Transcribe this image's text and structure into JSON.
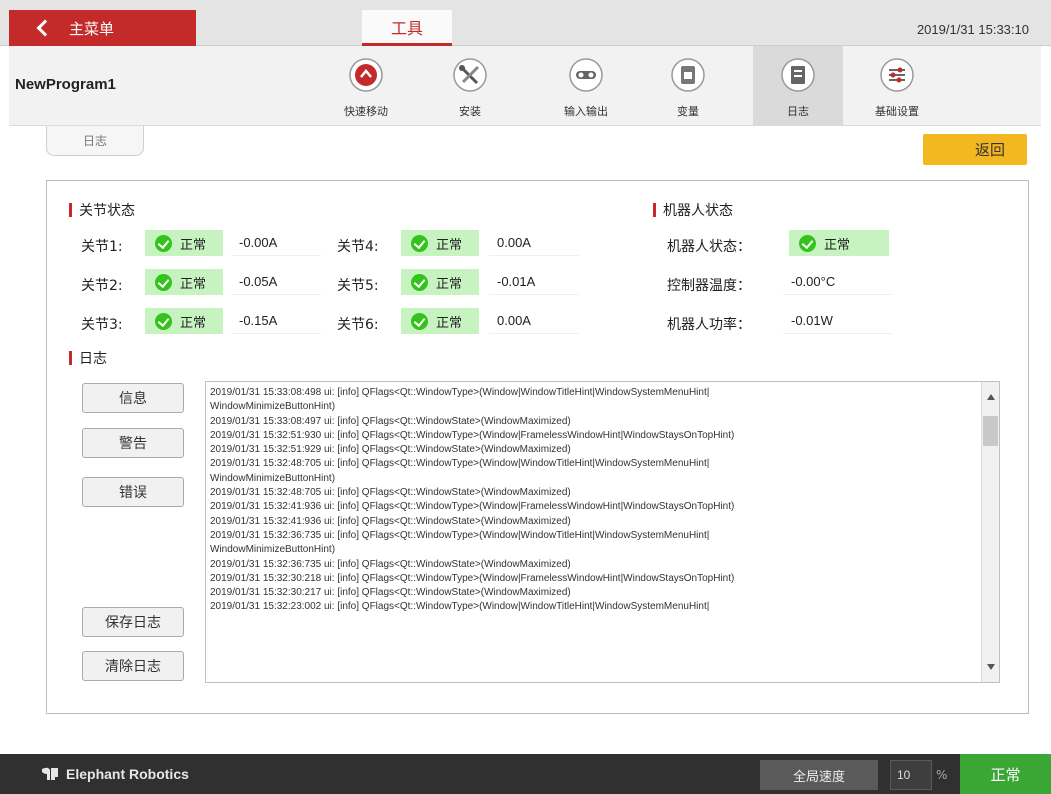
{
  "header": {
    "back_label": "主菜单",
    "active_tab": "工具",
    "datetime": "2019/1/31 15:33:10"
  },
  "toolbar": {
    "program_name": "NewProgram1",
    "tools": [
      {
        "label": "快速移动",
        "icon": "jog-icon"
      },
      {
        "label": "安装",
        "icon": "wrench-icon"
      },
      {
        "label": "输入输出",
        "icon": "io-icon"
      },
      {
        "label": "变量",
        "icon": "variable-icon"
      },
      {
        "label": "日志",
        "icon": "log-icon"
      },
      {
        "label": "基础设置",
        "icon": "settings-icon"
      }
    ],
    "active_tool": "日志"
  },
  "subheader": {
    "tab_label": "日志",
    "back_button": "返回"
  },
  "joint_status": {
    "title": "关节状态",
    "joints": [
      {
        "label": "关节1:",
        "status": "正常",
        "value": "-0.00A"
      },
      {
        "label": "关节2:",
        "status": "正常",
        "value": "-0.05A"
      },
      {
        "label": "关节3:",
        "status": "正常",
        "value": "-0.15A"
      },
      {
        "label": "关节4:",
        "status": "正常",
        "value": "0.00A"
      },
      {
        "label": "关节5:",
        "status": "正常",
        "value": "-0.01A"
      },
      {
        "label": "关节6:",
        "status": "正常",
        "value": "0.00A"
      }
    ]
  },
  "robot_status": {
    "title": "机器人状态",
    "state_label": "机器人状态：",
    "state_value": "正常",
    "temp_label": "控制器温度：",
    "temp_value": "-0.00°C",
    "power_label": "机器人功率：",
    "power_value": "-0.01W"
  },
  "log": {
    "title": "日志",
    "buttons": {
      "info": "信息",
      "warning": "警告",
      "error": "错误",
      "save": "保存日志",
      "clear": "清除日志"
    },
    "text": "2019/01/31 15:33:08:498 ui: [info] QFlags<Qt::WindowType>(Window|WindowTitleHint|WindowSystemMenuHint|\nWindowMinimizeButtonHint)\n2019/01/31 15:33:08:497 ui: [info] QFlags<Qt::WindowState>(WindowMaximized)\n2019/01/31 15:32:51:930 ui: [info] QFlags<Qt::WindowType>(Window|FramelessWindowHint|WindowStaysOnTopHint)\n2019/01/31 15:32:51:929 ui: [info] QFlags<Qt::WindowState>(WindowMaximized)\n2019/01/31 15:32:48:705 ui: [info] QFlags<Qt::WindowType>(Window|WindowTitleHint|WindowSystemMenuHint|\nWindowMinimizeButtonHint)\n2019/01/31 15:32:48:705 ui: [info] QFlags<Qt::WindowState>(WindowMaximized)\n2019/01/31 15:32:41:936 ui: [info] QFlags<Qt::WindowType>(Window|FramelessWindowHint|WindowStaysOnTopHint)\n2019/01/31 15:32:41:936 ui: [info] QFlags<Qt::WindowState>(WindowMaximized)\n2019/01/31 15:32:36:735 ui: [info] QFlags<Qt::WindowType>(Window|WindowTitleHint|WindowSystemMenuHint|\nWindowMinimizeButtonHint)\n2019/01/31 15:32:36:735 ui: [info] QFlags<Qt::WindowState>(WindowMaximized)\n2019/01/31 15:32:30:218 ui: [info] QFlags<Qt::WindowType>(Window|FramelessWindowHint|WindowStaysOnTopHint)\n2019/01/31 15:32:30:217 ui: [info] QFlags<Qt::WindowState>(WindowMaximized)\n2019/01/31 15:32:23:002 ui: [info] QFlags<Qt::WindowType>(Window|WindowTitleHint|WindowSystemMenuHint|"
  },
  "footer": {
    "brand": "Elephant Robotics",
    "speed_label": "全局速度",
    "speed_value": "10",
    "speed_unit": "%",
    "state": "正常"
  },
  "colors": {
    "accent_red": "#c42a2a",
    "back_yellow": "#f3b71f",
    "ok_green": "#34c21c",
    "ok_bg": "#c7f3c1",
    "footer_bg": "#303030",
    "status_green": "#3aa634"
  }
}
